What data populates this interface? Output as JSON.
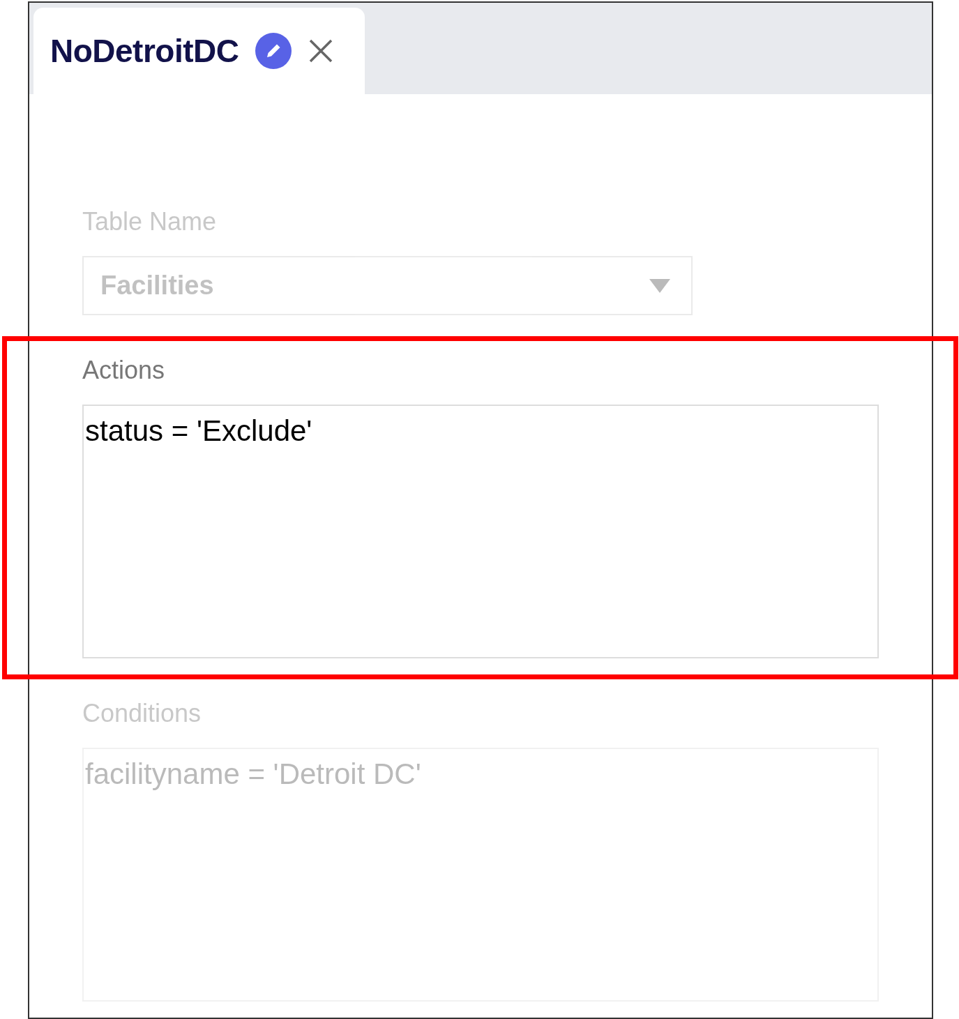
{
  "tab": {
    "title": "NoDetroitDC"
  },
  "fields": [
    {
      "label": "Table Name",
      "kind": "select",
      "value": "Facilities",
      "dimmed": true,
      "highlighted": false
    },
    {
      "label": "Actions",
      "kind": "textarea",
      "value": "status = 'Exclude'",
      "dimmed": false,
      "highlighted": true
    },
    {
      "label": "Conditions",
      "kind": "textarea",
      "value": "facilityname = 'Detroit DC'",
      "dimmed": true,
      "highlighted": false
    }
  ]
}
